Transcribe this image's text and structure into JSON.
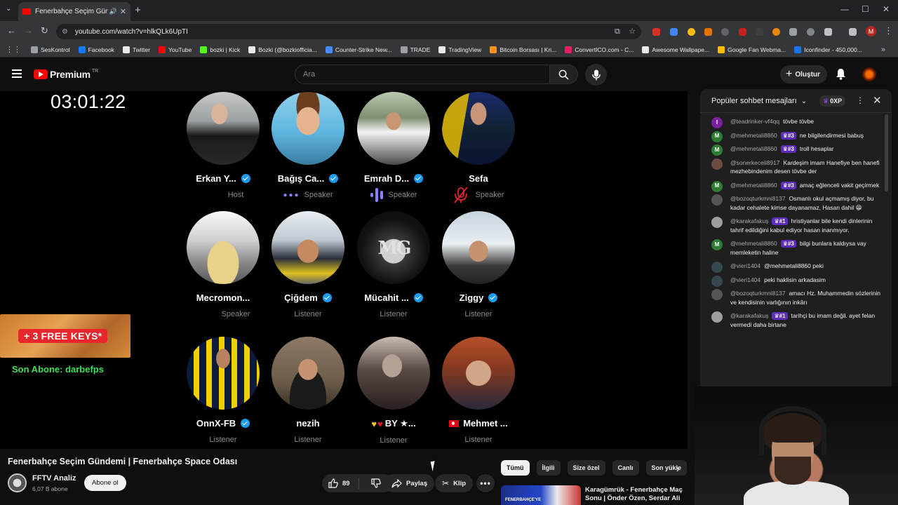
{
  "browser": {
    "tab_title": "Fenerbahçe Seçim Gündemi",
    "url": "youtube.com/watch?v=hlkQLk6UpTI",
    "bookmarks": [
      {
        "label": "SesKontrol",
        "color": "#9aa0a6"
      },
      {
        "label": "Facebook",
        "color": "#1877f2"
      },
      {
        "label": "Twitter",
        "color": "#e8eaed"
      },
      {
        "label": "YouTube",
        "color": "#ff0000"
      },
      {
        "label": "bozki | Kick",
        "color": "#53fc18"
      },
      {
        "label": "Bozki (@bozkiofficia...",
        "color": "#e8eaed"
      },
      {
        "label": "Counter-Strike New...",
        "color": "#4a8af4"
      },
      {
        "label": "TRADE",
        "color": "#9aa0a6"
      },
      {
        "label": "TradingView",
        "color": "#e8eaed"
      },
      {
        "label": "Bitcoin Borsası | Kri...",
        "color": "#f7931a"
      },
      {
        "label": "ConvertICO.com - C...",
        "color": "#e91e63"
      },
      {
        "label": "Awesome Wallpape...",
        "color": "#e8eaed"
      },
      {
        "label": "Google Fan Webma...",
        "color": "#fbbc05"
      },
      {
        "label": "Iconfinder - 450,000...",
        "color": "#1a73e8"
      }
    ]
  },
  "header": {
    "logo_word": "Premium",
    "logo_country": "TR",
    "search_placeholder": "Ara",
    "create_label": "Oluştur"
  },
  "player": {
    "clock": "03:01:22",
    "promo_label": "+ 3 FREE KEYS*",
    "subscriber_text": "Son Abone: darbefps",
    "speakers": [
      {
        "name": "Erkan Y...",
        "role": "Host",
        "verified": true,
        "indicator": "none",
        "avatar": "erkan"
      },
      {
        "name": "Bağış Ca...",
        "role": "Speaker",
        "verified": true,
        "indicator": "dots",
        "avatar": "bagis"
      },
      {
        "name": "Emrah D...",
        "role": "Speaker",
        "verified": true,
        "indicator": "bars",
        "avatar": "emrah"
      },
      {
        "name": "Sefa",
        "role": "Speaker",
        "verified": false,
        "indicator": "muted",
        "avatar": "sefa"
      },
      {
        "name": "Mecromon...",
        "role": "Speaker",
        "verified": false,
        "indicator": "none",
        "avatar": "mecro"
      },
      {
        "name": "Çiğdem",
        "role": "Listener",
        "verified": true,
        "indicator": "none",
        "avatar": "cigdem"
      },
      {
        "name": "Mücahit ...",
        "role": "Listener",
        "verified": true,
        "indicator": "none",
        "avatar": "mucahit"
      },
      {
        "name": "Ziggy",
        "role": "Listener",
        "verified": true,
        "indicator": "none",
        "avatar": "ziggy"
      },
      {
        "name": "OnnX-FB",
        "role": "Listener",
        "verified": true,
        "indicator": "none",
        "avatar": "onnx"
      },
      {
        "name": "nezih",
        "role": "Listener",
        "verified": false,
        "indicator": "none",
        "avatar": "nezih"
      },
      {
        "name": "BY ★...",
        "role": "Listener",
        "verified": false,
        "indicator": "none",
        "avatar": "by",
        "prefix": "hearts"
      },
      {
        "name": "Mehmet ...",
        "role": "Listener",
        "verified": false,
        "indicator": "none",
        "avatar": "mehmet",
        "prefix": "flag"
      }
    ]
  },
  "chat": {
    "title": "Popüler sohbet mesajları",
    "xp_label": "0XP",
    "messages": [
      {
        "author": "@teadrinker-vf4qq",
        "badge": "",
        "text": "tövbe tövbe",
        "initial": "I",
        "color": "#7b1fa2"
      },
      {
        "author": "@mehmetali8860",
        "badge": "#3",
        "text": "ne bilgilendirmesi babuş",
        "initial": "M",
        "color": "#2e7d32"
      },
      {
        "author": "@mehmetali8860",
        "badge": "#3",
        "text": "troll hesaplar",
        "initial": "M",
        "color": "#2e7d32"
      },
      {
        "author": "@sonerkeceli8917",
        "badge": "",
        "text": "Kardeşim imam Hanefiye ben hanefi mezhebindenim desen tövbe der",
        "initial": "",
        "color": "#6d4c41"
      },
      {
        "author": "@mehmetali8860",
        "badge": "#3",
        "text": "amaç eğlenceli vakit geçirmek",
        "initial": "M",
        "color": "#2e7d32"
      },
      {
        "author": "@bozoqturkmni8137",
        "badge": "",
        "text": "Osmanlı okul açmamış diyor, bu kadar cehalete kimse dayanamaz, Hasan dahil 😁",
        "initial": "",
        "color": "#555555"
      },
      {
        "author": "@karakafakuş",
        "badge": "#1",
        "text": "hristiyanlar bile kendi dinlerinin tahrif edildiğini kabul ediyor hasan inanmıyor.",
        "initial": "",
        "color": "#9e9e9e"
      },
      {
        "author": "@mehmetali8860",
        "badge": "#3",
        "text": "bilgi bunlara kaldıysa vay memleketin haline",
        "initial": "M",
        "color": "#2e7d32"
      },
      {
        "author": "@vieri1404",
        "badge": "",
        "text": "@mehmetali8860 peki",
        "initial": "",
        "color": "#37474f"
      },
      {
        "author": "@vieri1404",
        "badge": "",
        "text": "peki haklisin arkadasim",
        "initial": "",
        "color": "#37474f"
      },
      {
        "author": "@bozoqturkmni8137",
        "badge": "",
        "text": "amacı Hz. Muhammedin sözlerinin ve kendisinin varlığının inkârı",
        "initial": "",
        "color": "#555555"
      },
      {
        "author": "@karakafakuş",
        "badge": "#1",
        "text": "tarihçi bu imam değil. ayet felan vermedi daha birtane",
        "initial": "",
        "color": "#9e9e9e"
      }
    ]
  },
  "video": {
    "title": "Fenerbahçe Seçim Gündemi | Fenerbahçe Space Odası",
    "channel": "FFTV Analiz",
    "subscribers": "6,07 B abone",
    "subscribe_label": "Abone ol",
    "likes": "89",
    "share_label": "Paylaş",
    "clip_label": "Klip"
  },
  "chips": [
    "Tümü",
    "İlgili",
    "Size özel",
    "Canlı",
    "Son yükle"
  ],
  "recommendation": {
    "title": "Karagümrük - Fenerbahçe Maç Sonu | Önder Özen, Serdar Ali ...",
    "thumb_text": "FENERBAHÇE'YE"
  }
}
